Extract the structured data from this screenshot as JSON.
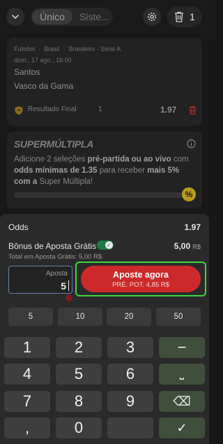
{
  "topbar": {
    "tabs": [
      {
        "label": "Único",
        "active": true
      },
      {
        "label": "Siste...",
        "active": false
      }
    ],
    "bet_count": "1",
    "icons": {
      "collapse": "chevron-down-icon",
      "settings": "gear-icon",
      "delete": "trash-icon"
    }
  },
  "bet_card": {
    "breadcrumb": [
      "Futebol",
      "Brasil",
      "Brasileiro - Série A"
    ],
    "datetime": "dom., 17 ago., 16:00",
    "home_team": "Santos",
    "away_team": "Vasco da Gama",
    "market": "Resultado Final",
    "selection": "1",
    "odd": "1.97",
    "icons": {
      "boost": "shield-boost-icon",
      "remove": "trash-icon"
    }
  },
  "promo": {
    "title": "SUPERMÚLTIPLA",
    "text_parts": [
      {
        "text": "Adicione 2 seleções ",
        "bold": false
      },
      {
        "text": "pré-partida ou ao vivo",
        "bold": true
      },
      {
        "text": " com ",
        "bold": false
      },
      {
        "text": "odds mínimas de 1.35",
        "bold": true
      },
      {
        "text": " para receber ",
        "bold": false
      },
      {
        "text": "mais 5% com a",
        "bold": true
      },
      {
        "text": " Super Múltipla!",
        "bold": false
      }
    ],
    "progress": 0,
    "badge": "%",
    "info_icon": "info-icon"
  },
  "betslip": {
    "odds_label": "Odds",
    "odds_value": "1.97",
    "bonus_label": "Bônus de Aposta Grátis",
    "bonus_enabled": true,
    "bonus_amount": "5,00",
    "bonus_currency": "R$",
    "total_line": "Total em Aposta Grátis: 5,00 R$",
    "stake_label": "Aposta",
    "stake_value": "5",
    "cta_label": "Aposte agora",
    "cta_sub": "PRÉ. POT. 4,85 R$",
    "quick_amounts": [
      "5",
      "10",
      "20",
      "50"
    ]
  },
  "keypad": {
    "keys": [
      "1",
      "2",
      "3",
      "−",
      "4",
      "5",
      "6",
      "⎵",
      "7",
      "8",
      "9",
      "⌫",
      ",",
      "0",
      "",
      "✓"
    ]
  },
  "colors": {
    "cta": "#cc2a2a",
    "highlight": "#3dd63a",
    "toggle_on": "#1f7a45",
    "badge": "#b89a1d"
  }
}
